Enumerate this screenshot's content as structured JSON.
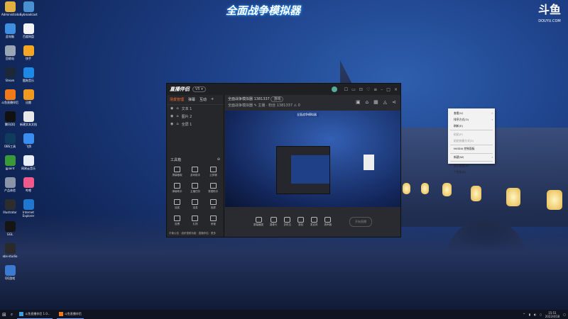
{
  "banner": {
    "title": "全面战争模拟器"
  },
  "watermark": {
    "logo": "斗鱼",
    "domain": "DOUYU.COM"
  },
  "desktop_icons": [
    {
      "label": "Administrator",
      "color": "#e0b040"
    },
    {
      "label": "Sybroadcast",
      "color": "#4a90d0"
    },
    {
      "label": "此电脑",
      "color": "#3f8fe0"
    },
    {
      "label": "百度网盘",
      "color": "#f2f4f8"
    },
    {
      "label": "回收站",
      "color": "#9aa6b4"
    },
    {
      "label": "快手",
      "color": "#f5a623"
    },
    {
      "label": "Steam",
      "color": "#1b2838"
    },
    {
      "label": "酷狗音乐",
      "color": "#1e88e5"
    },
    {
      "label": "斗鱼直播伴侣",
      "color": "#f07a1a"
    },
    {
      "label": "迅雷",
      "color": "#f09a20"
    },
    {
      "label": "腾讯QQ",
      "color": "#111111"
    },
    {
      "label": "新建文本文档",
      "color": "#e8e8e8"
    },
    {
      "label": "OBS工具",
      "color": "#0e3b5e"
    },
    {
      "label": "飞鸽",
      "color": "#3a8ef0"
    },
    {
      "label": "gpaint",
      "color": "#3a9a3a"
    },
    {
      "label": "网易云音乐",
      "color": "#e8eef8"
    },
    {
      "label": "产品体验",
      "color": "#8a94a8"
    },
    {
      "label": "哔哩",
      "color": "#ef5a8a"
    },
    {
      "label": "Illustrator",
      "color": "#2d2d2d"
    },
    {
      "label": "Internet Explorer",
      "color": "#1f77d0"
    },
    {
      "label": "GGL",
      "color": "#151515"
    },
    {
      "label": "obs-studio",
      "color": "#2a2a2a"
    },
    {
      "label": "QQ游戏",
      "color": "#3a7ad0"
    }
  ],
  "app": {
    "logo": "直播伴侣",
    "badge": "V5 ▾",
    "window_controls": [
      "☐",
      "▭",
      "⊡",
      "♡",
      "≡",
      "–",
      "□",
      "×"
    ],
    "tabs": [
      "场景管理",
      "弹幕",
      "互动",
      "+"
    ],
    "scenes": [
      {
        "label": "文本 1"
      },
      {
        "label": "图片 2"
      },
      {
        "label": "全屏 1"
      }
    ],
    "tools_title": "工具箱",
    "tools": [
      "屏幕截取",
      "游戏助手",
      "云剪辑",
      "弹幕助手",
      "主播任务",
      "数据助手",
      "抽奖",
      "连麦",
      "投屏",
      "投票",
      "礼物",
      "房管"
    ],
    "room_title": "全面战争模拟器 1381337",
    "room_tag": "游戏",
    "room_sub": "全面战争模拟器 ✎  主播 · 粉丝 1381337  ⚠ 0",
    "preview_title": "全面战争模拟器",
    "bottom_buttons": [
      "屏幕截图",
      "摄像头",
      "多机位",
      "录制",
      "麦克风",
      "扬声器"
    ],
    "go_live": "开始直播",
    "footer": "平衡公告 · 组织视频功能 · 直播伴侣 · 更多"
  },
  "context_menu": [
    {
      "label": "查看(V)",
      "arrow": true
    },
    {
      "label": "排序方式(O)",
      "arrow": true
    },
    {
      "label": "刷新(E)"
    },
    {
      "sep": true
    },
    {
      "label": "粘贴(P)",
      "disabled": true
    },
    {
      "label": "粘贴快捷方式(S)",
      "disabled": true
    },
    {
      "sep": true
    },
    {
      "label": "NVIDIA 控制面板"
    },
    {
      "sep": true
    },
    {
      "label": "新建(W)",
      "arrow": true
    },
    {
      "sep": true
    },
    {
      "label": "显示设置(D)"
    },
    {
      "label": "个性化(R)"
    }
  ],
  "taskbar": {
    "items": [
      "斗鱼直播伴侣 1.0...",
      "斗鱼直播伴侣"
    ],
    "time": "15:51",
    "date": "2022/4/18"
  }
}
